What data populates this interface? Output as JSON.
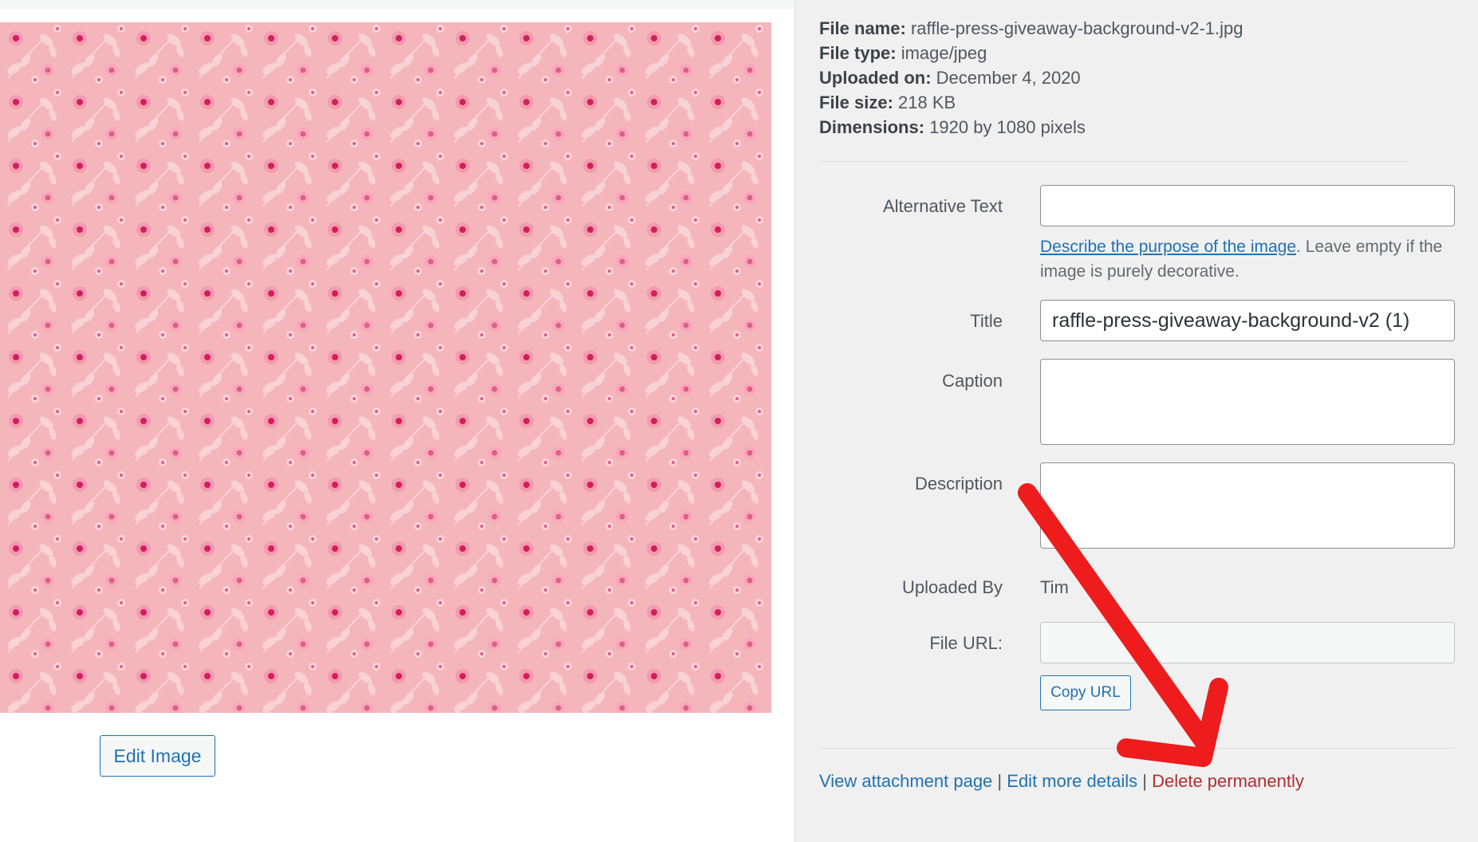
{
  "left": {
    "preview_alt": "raffle-press-giveaway-background-v2-1.jpg",
    "edit_image_label": "Edit Image"
  },
  "details": {
    "file_name_label": "File name:",
    "file_name": "raffle-press-giveaway-background-v2-1.jpg",
    "file_type_label": "File type:",
    "file_type": "image/jpeg",
    "uploaded_on_label": "Uploaded on:",
    "uploaded_on": "December 4, 2020",
    "file_size_label": "File size:",
    "file_size": "218 KB",
    "dimensions_label": "Dimensions:",
    "dimensions": "1920 by 1080 pixels"
  },
  "form": {
    "alt_text_label": "Alternative Text",
    "alt_text_value": "",
    "alt_help_link": "Describe the purpose of the image",
    "alt_help_rest": ". Leave empty if the image is purely decorative.",
    "title_label": "Title",
    "title_value": "raffle-press-giveaway-background-v2 (1)",
    "caption_label": "Caption",
    "caption_value": "",
    "description_label": "Description",
    "description_value": "",
    "uploaded_by_label": "Uploaded By",
    "uploaded_by_value": "Tim",
    "file_url_label": "File URL:",
    "file_url_value": "",
    "copy_url_label": "Copy URL"
  },
  "actions": {
    "view_attachment": "View attachment page",
    "separator": "|",
    "edit_more": "Edit more details",
    "delete": "Delete permanently"
  },
  "colors": {
    "accent": "#2271b1",
    "danger": "#b32d2e",
    "annotation_arrow": "#ee1c1c",
    "preview_bg": "#f4b6bb",
    "flower_dark": "#e35c87",
    "flower_light": "#f9d2d6"
  },
  "icons": {
    "annotation": "red-arrow-icon"
  }
}
